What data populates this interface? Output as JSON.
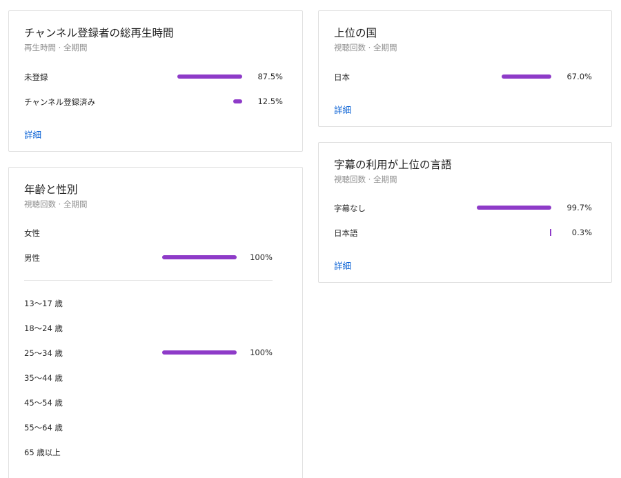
{
  "subscribers": {
    "title": "チャンネル登録者の総再生時間",
    "subtitle": "再生時間 · 全期間",
    "rows": [
      {
        "label": "未登録",
        "value": "87.5%",
        "fraction": 0.875
      },
      {
        "label": "チャンネル登録済み",
        "value": "12.5%",
        "fraction": 0.125
      }
    ],
    "link": "詳細"
  },
  "age_gender": {
    "title": "年齢と性別",
    "subtitle": "視聴回数 · 全期間",
    "gender_rows": [
      {
        "label": "女性",
        "value": "",
        "fraction": 0
      },
      {
        "label": "男性",
        "value": "100%",
        "fraction": 1.0
      }
    ],
    "age_rows": [
      {
        "label": "13〜17 歳",
        "value": "",
        "fraction": 0
      },
      {
        "label": "18〜24 歳",
        "value": "",
        "fraction": 0
      },
      {
        "label": "25〜34 歳",
        "value": "100%",
        "fraction": 1.0
      },
      {
        "label": "35〜44 歳",
        "value": "",
        "fraction": 0
      },
      {
        "label": "45〜54 歳",
        "value": "",
        "fraction": 0
      },
      {
        "label": "55〜64 歳",
        "value": "",
        "fraction": 0
      },
      {
        "label": "65 歳以上",
        "value": "",
        "fraction": 0
      }
    ]
  },
  "countries": {
    "title": "上位の国",
    "subtitle": "視聴回数 · 全期間",
    "rows": [
      {
        "label": "日本",
        "value": "67.0%",
        "fraction": 0.67
      }
    ],
    "link": "詳細"
  },
  "subtitles": {
    "title": "字幕の利用が上位の言語",
    "subtitle": "視聴回数 · 全期間",
    "rows": [
      {
        "label": "字幕なし",
        "value": "99.7%",
        "fraction": 0.997
      },
      {
        "label": "日本語",
        "value": "0.3%",
        "fraction": 0.003
      }
    ],
    "link": "詳細"
  },
  "colors": {
    "bar": "#8e3bc8",
    "link": "#065fd4"
  }
}
